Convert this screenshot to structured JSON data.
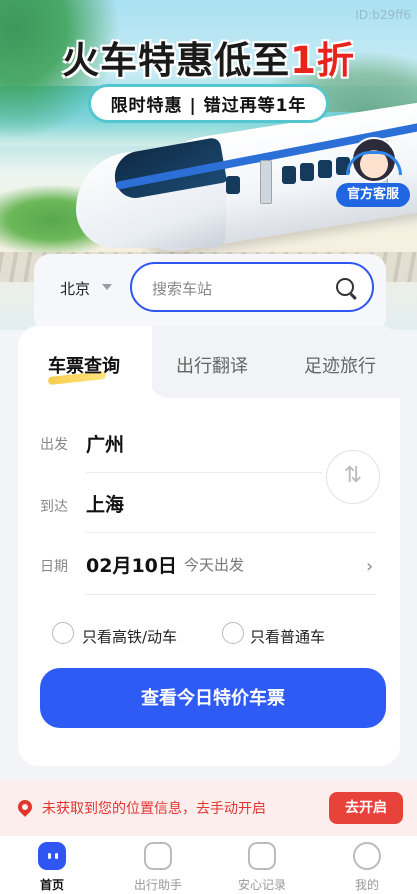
{
  "watermark": "ID:b29ff6",
  "hero": {
    "title_prefix": "火车特惠低至",
    "title_highlight": "1折",
    "subtitle": "限时特惠 | 错过再等1年",
    "service_label": "官方客服"
  },
  "search": {
    "city": "北京",
    "placeholder": "搜索车站"
  },
  "tabs": [
    {
      "label": "车票查询",
      "active": true
    },
    {
      "label": "出行翻译",
      "active": false
    },
    {
      "label": "足迹旅行",
      "active": false
    }
  ],
  "form": {
    "from_label": "出发",
    "from_value": "广州",
    "to_label": "到达",
    "to_value": "上海",
    "date_label": "日期",
    "date_value": "02月10日",
    "date_hint": "今天出发",
    "option_highspeed": "只看高铁/动车",
    "option_normal": "只看普通车",
    "submit": "查看今日特价车票"
  },
  "location_banner": {
    "message": "未获取到您的位置信息，去手动开启",
    "button": "去开启"
  },
  "nav": [
    {
      "label": "首页",
      "icon": "home-icon",
      "active": true
    },
    {
      "label": "出行助手",
      "icon": "chart-icon",
      "active": false
    },
    {
      "label": "安心记录",
      "icon": "briefcase-icon",
      "active": false
    },
    {
      "label": "我的",
      "icon": "user-icon",
      "active": false
    }
  ],
  "colors": {
    "accent": "#2f56f2",
    "alert": "#e8433a",
    "title_highlight": "#e8231b"
  }
}
